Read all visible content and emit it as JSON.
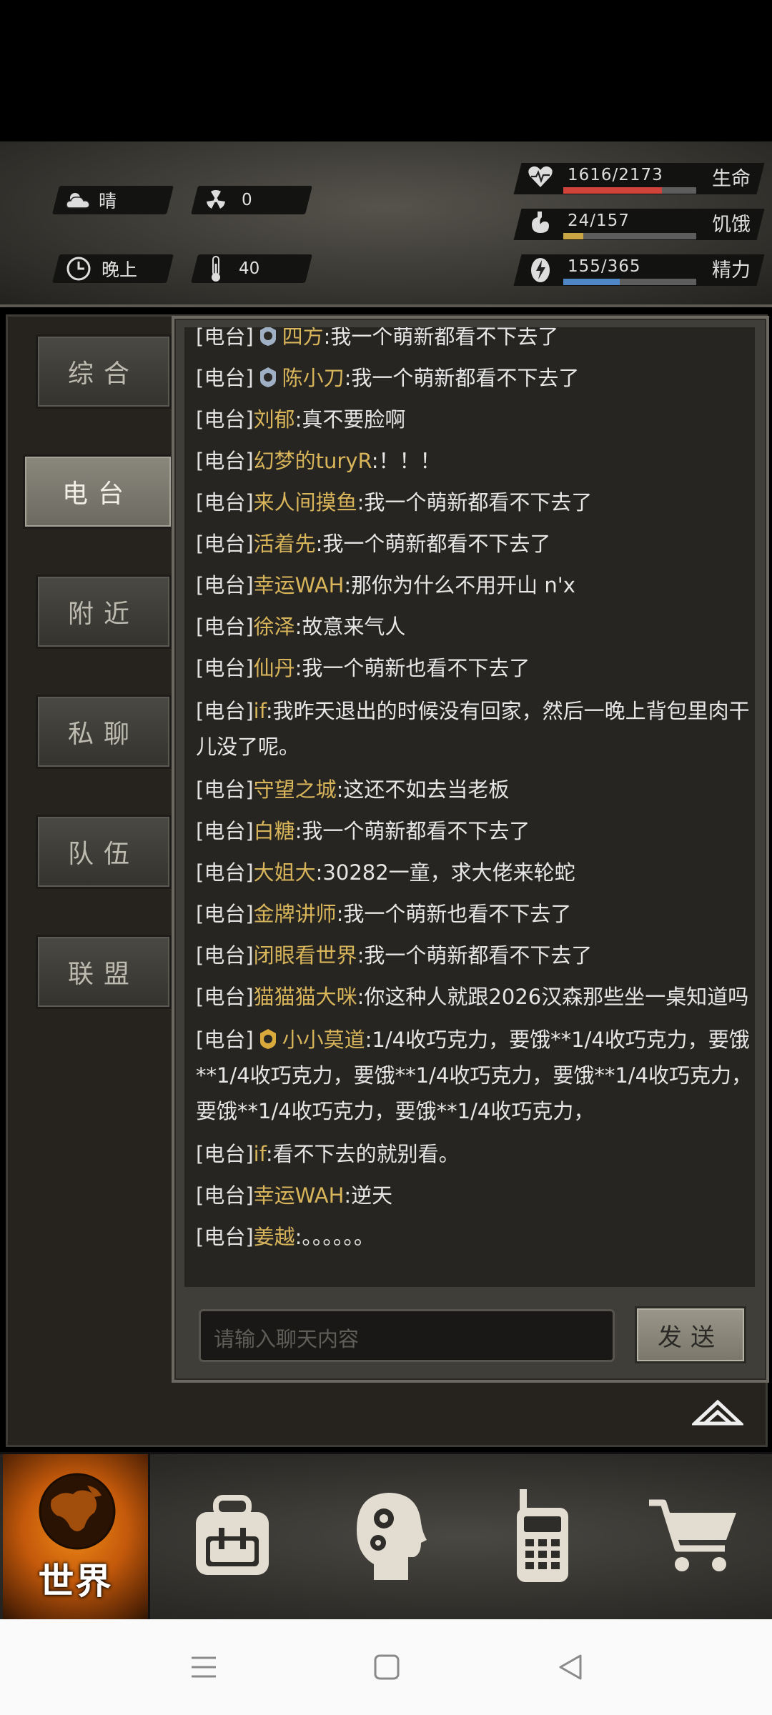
{
  "status": {
    "weather": "晴",
    "radiation": "0",
    "time_of_day": "晚上",
    "temperature": "40",
    "health": {
      "value": "1616/2173",
      "label": "生命",
      "ratio": 0.744,
      "color": "#d0433a"
    },
    "hunger": {
      "value": "24/157",
      "label": "饥饿",
      "ratio": 0.153,
      "color": "#c9a544"
    },
    "energy": {
      "value": "155/365",
      "label": "精力",
      "ratio": 0.425,
      "color": "#4e86c6"
    }
  },
  "tabs": [
    {
      "label": "综合",
      "active": false
    },
    {
      "label": "电台",
      "active": true
    },
    {
      "label": "附近",
      "active": false
    },
    {
      "label": "私聊",
      "active": false
    },
    {
      "label": "队伍",
      "active": false
    },
    {
      "label": "联盟",
      "active": false
    }
  ],
  "messages": [
    {
      "channel": "[电台]",
      "badge": "silver",
      "name": "四方",
      "text": ":我一个萌新都看不下去了"
    },
    {
      "channel": "[电台]",
      "badge": "silver",
      "name": "陈小刀",
      "text": ":我一个萌新都看不下去了"
    },
    {
      "channel": "[电台]",
      "name": "刘郁",
      "text": ":真不要脸啊"
    },
    {
      "channel": "[电台]",
      "name": "幻梦的turyR",
      "text": ":！！！"
    },
    {
      "channel": "[电台]",
      "name": "来人间摸鱼",
      "text": ":我一个萌新都看不下去了"
    },
    {
      "channel": "[电台]",
      "name": "活着先",
      "text": ":我一个萌新都看不下去了"
    },
    {
      "channel": "[电台]",
      "name": "幸运WAH",
      "text": ":那你为什么不用开山 n'x"
    },
    {
      "channel": "[电台]",
      "name": "徐泽",
      "text": ":故意来气人"
    },
    {
      "channel": "[电台]",
      "name": "仙丹",
      "text": ":我一个萌新也看不下去了"
    },
    {
      "channel": "[电台]",
      "name": "if",
      "text": ":我昨天退出的时候没有回家，然后一晚上背包里肉干儿没了呢。",
      "wrap": true
    },
    {
      "channel": "[电台]",
      "name": "守望之城",
      "text": ":这还不如去当老板"
    },
    {
      "channel": "[电台]",
      "name": "白糖",
      "text": ":我一个萌新都看不下去了"
    },
    {
      "channel": "[电台]",
      "name": "大姐大",
      "text": ":30282一童，求大佬来轮蛇"
    },
    {
      "channel": "[电台]",
      "name": "金牌讲师",
      "text": ":我一个萌新也看不下去了"
    },
    {
      "channel": "[电台]",
      "name": "闭眼看世界",
      "text": ":我一个萌新都看不下去了"
    },
    {
      "channel": "[电台]",
      "name": "猫猫猫大咪",
      "text": ":你这种人就跟2026汉森那些坐一桌知道吗"
    },
    {
      "channel": "[电台]",
      "badge": "gold",
      "name": "小小莫道",
      "text": ":1/4收巧克力，要饿**1/4收巧克力，要饿**1/4收巧克力，要饿**1/4收巧克力，要饿**1/4收巧克力，要饿**1/4收巧克力，要饿**1/4收巧克力，",
      "wrap": true
    },
    {
      "channel": "[电台]",
      "name": "if",
      "text": ":看不下去的就别看。"
    },
    {
      "channel": "[电台]",
      "name": "幸运WAH",
      "text": ":逆天"
    },
    {
      "channel": "[电台]",
      "name": "姜越",
      "text": ":。。。。。。"
    }
  ],
  "input": {
    "placeholder": "请输入聊天内容",
    "value": ""
  },
  "send_label": "发送",
  "nav": {
    "world_label": "世界",
    "items": [
      "world",
      "backpack",
      "skills",
      "radio",
      "shop"
    ]
  }
}
